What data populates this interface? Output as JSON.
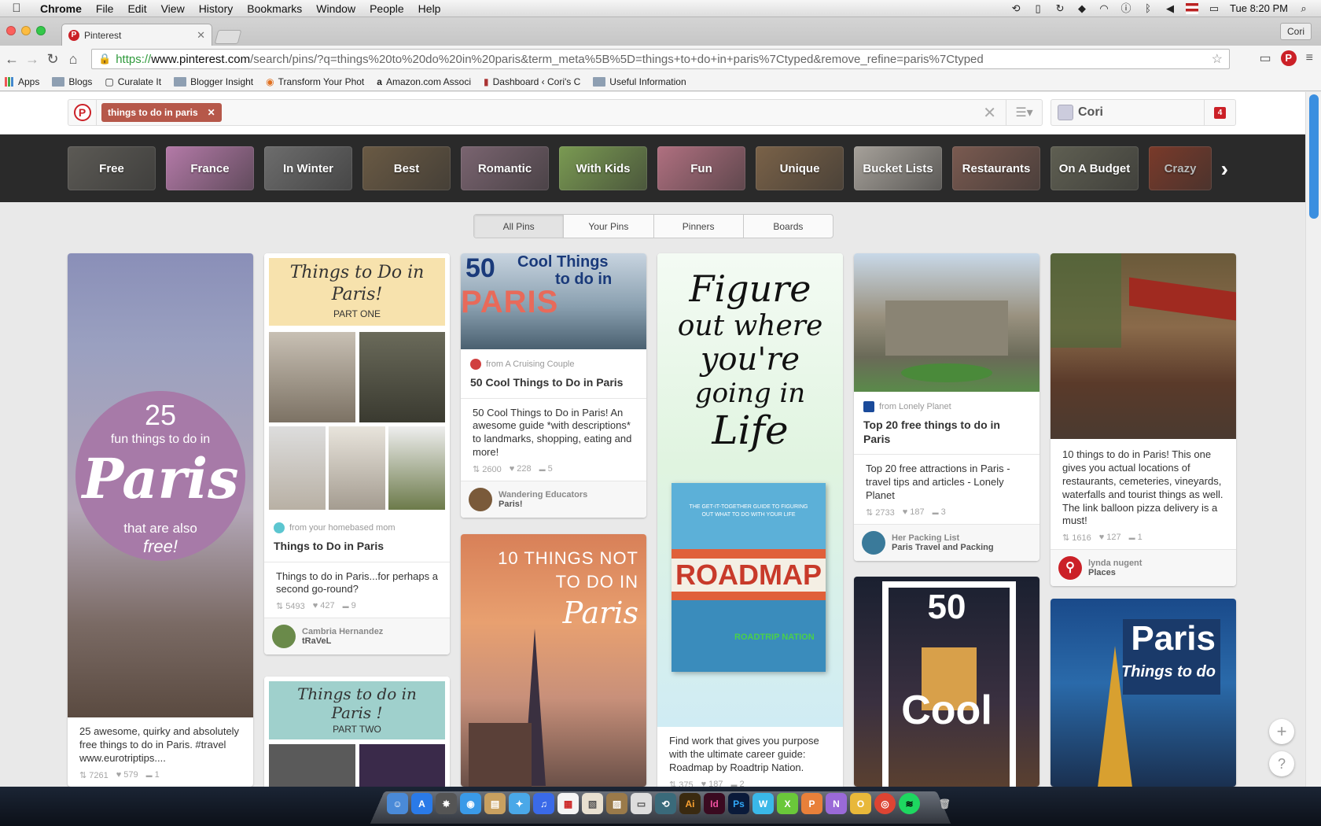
{
  "menubar": {
    "app": "Chrome",
    "items": [
      "File",
      "Edit",
      "View",
      "History",
      "Bookmarks",
      "Window",
      "People",
      "Help"
    ],
    "clock": "Tue 8:20 PM"
  },
  "browser": {
    "tab_title": "Pinterest",
    "profile": "Cori",
    "url_scheme": "https://",
    "url_host": "www.pinterest.com",
    "url_path": "/search/pins/?q=things%20to%20do%20in%20paris&term_meta%5B%5D=things+to+do+in+paris%7Ctyped&remove_refine=paris%7Ctyped",
    "bookmarks": [
      "Apps",
      "Blogs",
      "Curalate It",
      "Blogger Insight",
      "Transform Your Phot",
      "Amazon.com Associ",
      "Dashboard ‹ Cori's C",
      "Useful Information"
    ]
  },
  "search": {
    "query_chip": "things to do in paris",
    "user_name": "Cori",
    "notification_count": "4"
  },
  "guides": [
    {
      "label": "Free",
      "color": "#5c5a55"
    },
    {
      "label": "France",
      "color": "#b47aa8"
    },
    {
      "label": "In Winter",
      "color": "#6d6d6d"
    },
    {
      "label": "Best",
      "color": "#6a5a44"
    },
    {
      "label": "Romantic",
      "color": "#7a6470"
    },
    {
      "label": "With Kids",
      "color": "#7a9a52"
    },
    {
      "label": "Fun",
      "color": "#b07080"
    },
    {
      "label": "Unique",
      "color": "#7a6248"
    },
    {
      "label": "Bucket Lists",
      "color": "#a6a19a"
    },
    {
      "label": "Restaurants",
      "color": "#7a5a50"
    },
    {
      "label": "On A Budget",
      "color": "#5f5f52"
    },
    {
      "label": "Crazy",
      "color": "#7a3a2a"
    }
  ],
  "filter_tabs": [
    "All Pins",
    "Your Pins",
    "Pinners",
    "Boards"
  ],
  "pins": {
    "p1": {
      "art": {
        "big": "25",
        "small": "fun things to do in",
        "word": "Paris",
        "sub": "that are also",
        "sub2": "free!"
      },
      "desc": "25 awesome, quirky and absolutely free things to do in Paris. #travel www.eurotriptips....",
      "repins": "7261",
      "likes": "579",
      "comments": "1"
    },
    "p2": {
      "art": {
        "line1": "Things to Do in",
        "line2": "Paris!",
        "line3": "PART ONE"
      },
      "source": "from your homebased mom",
      "title": "Things to Do in Paris",
      "desc": "Things to do in Paris...for perhaps a second go-round?",
      "repins": "5493",
      "likes": "427",
      "comments": "9",
      "pinner": "Cambria Hernandez",
      "board": "tRaVeL"
    },
    "p2b": {
      "art": {
        "line1": "Things to do in",
        "line2": "Paris !",
        "line3": "PART TWO"
      }
    },
    "p3": {
      "art": {
        "num": "50",
        "top": "Cool Things",
        "mid": "to do in",
        "word": "PARIS"
      },
      "source": "from A Cruising Couple",
      "title": "50 Cool Things to Do in Paris",
      "desc": "50 Cool Things to Do in Paris! An awesome guide *with descriptions* to landmarks, shopping, eating and more!",
      "repins": "2600",
      "likes": "228",
      "comments": "5",
      "pinner": "Wandering Educators",
      "board": "Paris!"
    },
    "p3b": {
      "art": {
        "line1": "10 THINGS NOT",
        "line2": "TO DO IN",
        "word": "Paris"
      }
    },
    "p4": {
      "art": {
        "l1": "Figure",
        "l2": "out where",
        "l3": "you're",
        "l4": "going in",
        "l5": "Life",
        "book_top": "THE GET-IT-TOGETHER GUIDE TO FIGURING OUT WHAT TO DO WITH YOUR LIFE",
        "book_title": "ROADMAP",
        "book_brand": "ROADTRIP NATION"
      },
      "desc": "Find work that gives you purpose with the ultimate career guide: Roadmap by Roadtrip Nation.",
      "repins": "375",
      "likes": "187",
      "comments": "2"
    },
    "p5": {
      "source": "from Lonely Planet",
      "title": "Top 20 free things to do in Paris",
      "desc": "Top 20 free attractions in Paris - travel tips and articles - Lonely Planet",
      "repins": "2733",
      "likes": "187",
      "comments": "3",
      "pinner": "Her Packing List",
      "board": "Paris Travel and Packing"
    },
    "p5b": {
      "art": {
        "num": "50",
        "word": "Cool"
      }
    },
    "p6": {
      "desc": "10 things to do in Paris! This one gives you actual locations of restaurants, cemeteries, vineyards, waterfalls and tourist things as well. The link balloon pizza delivery is a must!",
      "repins": "1616",
      "likes": "127",
      "comments": "1",
      "pinner": "lynda nugent",
      "board": "Places"
    },
    "p6b": {
      "art": {
        "word": "Paris",
        "sub": "Things to do"
      }
    }
  }
}
